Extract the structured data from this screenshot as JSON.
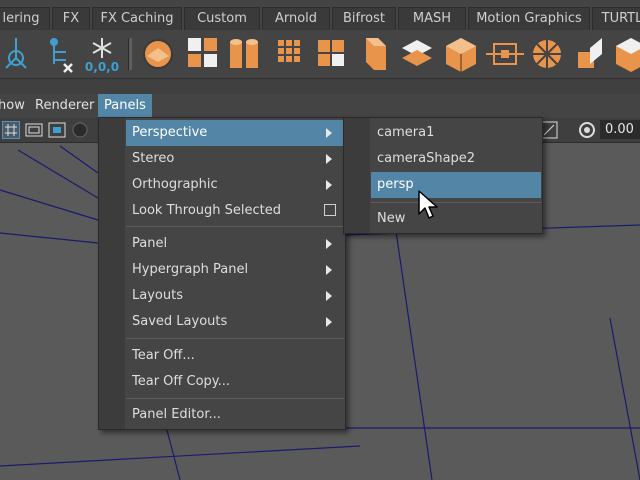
{
  "shelf_tabs": [
    "lering",
    "FX",
    "FX Caching",
    "Custom",
    "Arnold",
    "Bifrost",
    "MASH",
    "Motion Graphics",
    "TURTL"
  ],
  "shelf_icons": {
    "left": [
      "pivot-axis-icon",
      "delete-history-icon",
      "snowflake-icon"
    ],
    "snowflake_label": "0,0,0",
    "right": [
      "sphere-icon",
      "cubes-grid-icon",
      "cylinder-split-icon",
      "dot-grid-icon",
      "cube-stack-icon",
      "box-icon",
      "layers-icon",
      "cube-open-icon",
      "node-connect-icon",
      "wheel-icon",
      "cube-slice-icon",
      "cube-cut-icon"
    ]
  },
  "panel_menubar": {
    "items": [
      "how",
      "Renderer",
      "Panels"
    ]
  },
  "panel_toolbar": {
    "value": "0.00"
  },
  "panels_menu": {
    "items": [
      {
        "label": "Perspective",
        "submenu": true,
        "highlighted": true
      },
      {
        "label": "Stereo",
        "submenu": true
      },
      {
        "label": "Orthographic",
        "submenu": true
      },
      {
        "label": "Look Through Selected",
        "checkbox": true,
        "checked": false
      },
      {
        "label": "Panel",
        "submenu": true
      },
      {
        "label": "Hypergraph Panel",
        "submenu": true
      },
      {
        "label": "Layouts",
        "submenu": true
      },
      {
        "label": "Saved Layouts",
        "submenu": true
      },
      {
        "label": "Tear Off..."
      },
      {
        "label": "Tear Off Copy..."
      },
      {
        "label": "Panel Editor..."
      }
    ]
  },
  "perspective_submenu": {
    "items": [
      {
        "label": "camera1"
      },
      {
        "label": "cameraShape2"
      },
      {
        "label": "persp",
        "highlighted": true
      },
      {
        "label": "New"
      }
    ]
  },
  "colors": {
    "highlight": "#5285a6",
    "accent_orange": "#e8944a",
    "viewport_bg": "#5a5a5a",
    "grid_line": "#1a1a6e"
  }
}
